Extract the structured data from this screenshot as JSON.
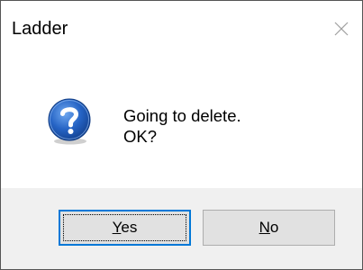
{
  "dialog": {
    "title": "Ladder",
    "close_icon": "close-icon",
    "icon": "question-icon",
    "message_lines": [
      "Going to delete.",
      "OK?"
    ]
  },
  "buttons": {
    "yes": {
      "label_rest": "es",
      "label_access_key": "Y",
      "is_default": true
    },
    "no": {
      "label_rest": "o",
      "label_access_key": "N",
      "is_default": false
    }
  },
  "colors": {
    "accent_border": "#0078d7",
    "footer_bg": "#f0f0f0",
    "button_bg": "#e1e1e1",
    "icon_blue": "#1c58b8"
  }
}
